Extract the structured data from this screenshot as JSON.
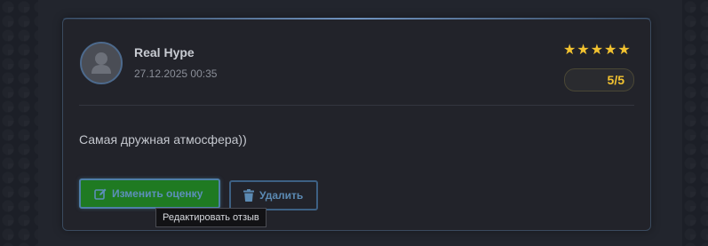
{
  "review": {
    "user_name": "Real Hype",
    "date": "27.12.2025 00:35",
    "stars": [
      "★",
      "★",
      "★",
      "★",
      "★"
    ],
    "rating": "5/5",
    "text": "Самая дружная атмосфера))"
  },
  "actions": {
    "edit_label": "Изменить оценку",
    "delete_label": "Удалить",
    "edit_tooltip": "Редактировать отзыв"
  },
  "colors": {
    "star": "#f2c230",
    "edit_button_bg": "#1f7a22",
    "accent_blue": "#5d8fba"
  },
  "icons": {
    "avatar": "user-silhouette-icon",
    "edit": "edit-icon",
    "delete": "trash-icon"
  }
}
